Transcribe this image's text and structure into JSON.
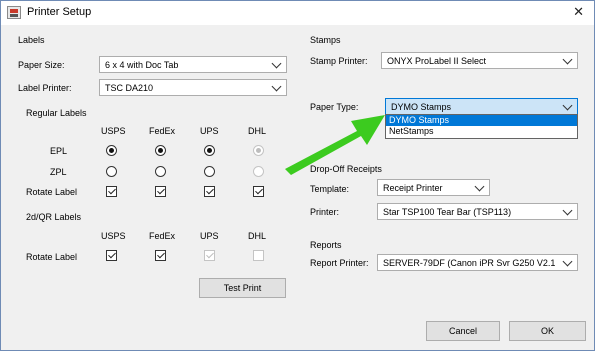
{
  "window": {
    "title": "Printer Setup",
    "close_icon": "close-icon"
  },
  "labels": {
    "section": "Labels",
    "paper_size": {
      "label": "Paper Size:",
      "value": "6 x 4 with Doc Tab"
    },
    "label_printer": {
      "label": "Label Printer:",
      "value": "TSC DA210"
    },
    "regular": {
      "title": "Regular Labels",
      "carriers": [
        "USPS",
        "FedEx",
        "UPS",
        "DHL"
      ],
      "rows": [
        {
          "label": "EPL",
          "type": "radio",
          "states": [
            true,
            true,
            true,
            true
          ],
          "disabled": [
            false,
            false,
            false,
            true
          ]
        },
        {
          "label": "ZPL",
          "type": "radio",
          "states": [
            false,
            false,
            false,
            false
          ],
          "disabled": [
            false,
            false,
            false,
            true
          ]
        },
        {
          "label": "Rotate Label",
          "type": "check",
          "states": [
            true,
            true,
            true,
            true
          ],
          "disabled": [
            false,
            false,
            false,
            false
          ]
        }
      ]
    },
    "twod": {
      "title": "2d/QR Labels",
      "carriers": [
        "USPS",
        "FedEx",
        "UPS",
        "DHL"
      ],
      "rotate_label": "Rotate Label",
      "states": [
        true,
        true,
        true,
        false
      ],
      "disabled": [
        false,
        false,
        true,
        true
      ]
    },
    "test_print": "Test Print"
  },
  "stamps": {
    "section": "Stamps",
    "stamp_printer": {
      "label": "Stamp Printer:",
      "value": "ONYX ProLabel II Select"
    },
    "paper_type": {
      "label": "Paper Type:",
      "value": "DYMO Stamps",
      "options": [
        "DYMO Stamps",
        "NetStamps"
      ]
    }
  },
  "dropoff": {
    "section": "Drop-Off Receipts",
    "template": {
      "label": "Template:",
      "value": "Receipt Printer"
    },
    "printer": {
      "label": "Printer:",
      "value": "Star TSP100 Tear Bar (TSP113)"
    }
  },
  "reports": {
    "section": "Reports",
    "report_printer": {
      "label": "Report Printer:",
      "value": "SERVER-79DF (Canon iPR Svr G250 V2.1"
    }
  },
  "buttons": {
    "cancel": "Cancel",
    "ok": "OK"
  },
  "colors": {
    "annotation_arrow": "#3ccb1f",
    "focus": "#0078d7"
  }
}
